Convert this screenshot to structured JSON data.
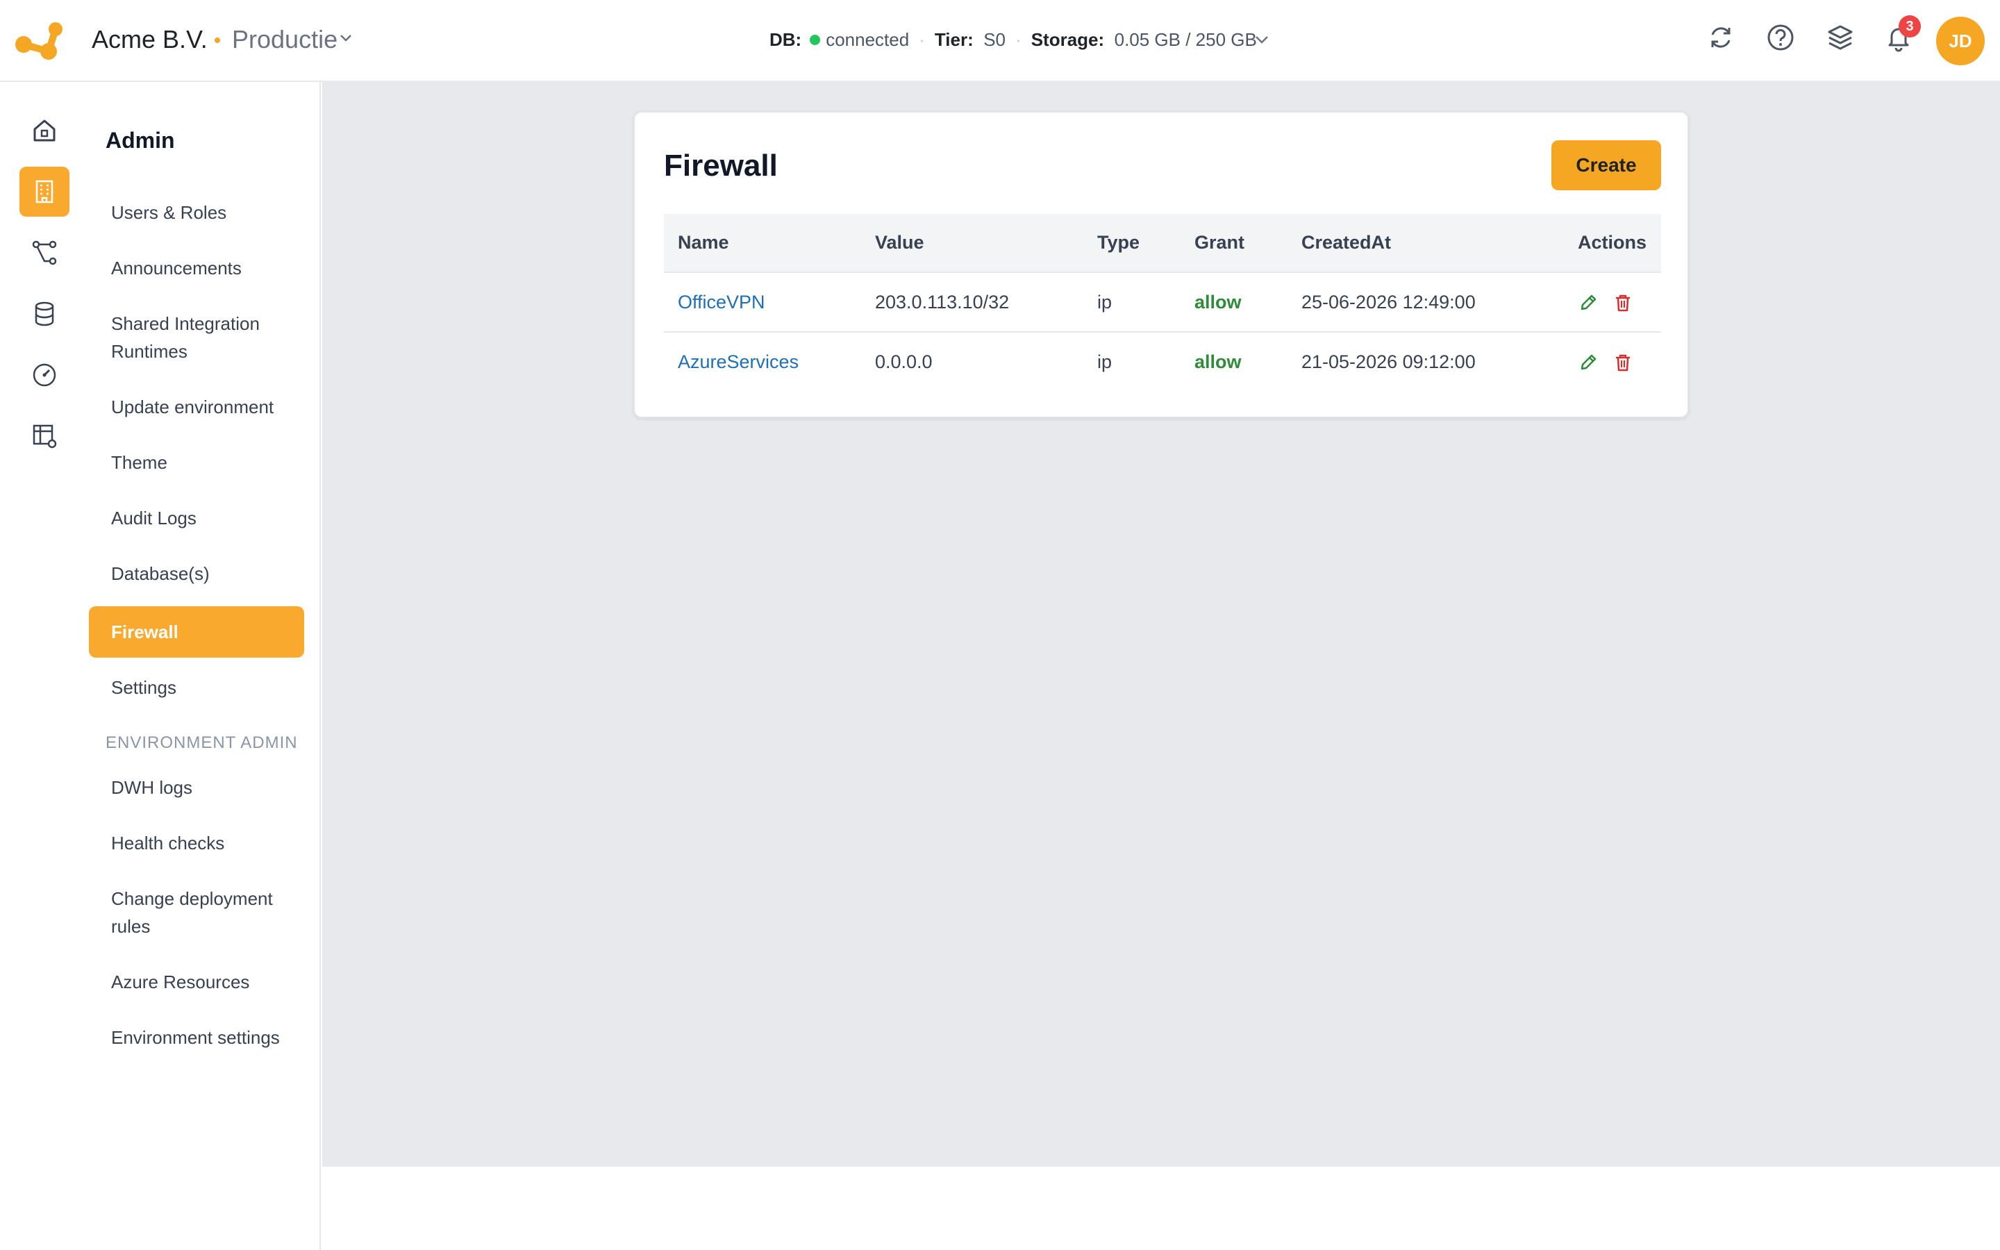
{
  "header": {
    "org_name": "Acme B.V.",
    "environment": "Productie",
    "status": {
      "db_label": "DB:",
      "db_value": "connected",
      "tier_label": "Tier:",
      "tier_value": "S0",
      "storage_label": "Storage:",
      "storage_value": "0.05 GB / 250 GB"
    },
    "notification_count": "3",
    "avatar_initials": "JD",
    "accent_color": "#f5a623"
  },
  "rail": {
    "items": [
      "home-icon",
      "building-icon",
      "pipeline-icon",
      "database-icon",
      "gauge-icon",
      "table-settings-icon"
    ],
    "active": "building-icon"
  },
  "sidebar": {
    "title": "Admin",
    "items": [
      {
        "label": "Users & Roles"
      },
      {
        "label": "Announcements"
      },
      {
        "label": "Shared Integration Runtimes"
      },
      {
        "label": "Update environment"
      },
      {
        "label": "Theme"
      },
      {
        "label": "Audit Logs"
      },
      {
        "label": "Database(s)"
      },
      {
        "label": "Firewall"
      },
      {
        "label": "Settings"
      }
    ],
    "active_item": "Firewall",
    "section_label": "ENVIRONMENT ADMIN",
    "env_items": [
      {
        "label": "DWH logs"
      },
      {
        "label": "Health checks"
      },
      {
        "label": "Change deployment rules"
      },
      {
        "label": "Azure Resources"
      },
      {
        "label": "Environment settings"
      }
    ]
  },
  "firewall": {
    "title": "Firewall",
    "create_label": "Create",
    "columns": [
      "Name",
      "Value",
      "Type",
      "Grant",
      "CreatedAt",
      "Actions"
    ],
    "rows": [
      {
        "name": "OfficeVPN",
        "value": "203.0.113.10/32",
        "type": "ip",
        "grant": "allow",
        "created_at": "25-06-2026 12:49:00"
      },
      {
        "name": "AzureServices",
        "value": "0.0.0.0",
        "type": "ip",
        "grant": "allow",
        "created_at": "21-05-2026 09:12:00"
      }
    ]
  }
}
